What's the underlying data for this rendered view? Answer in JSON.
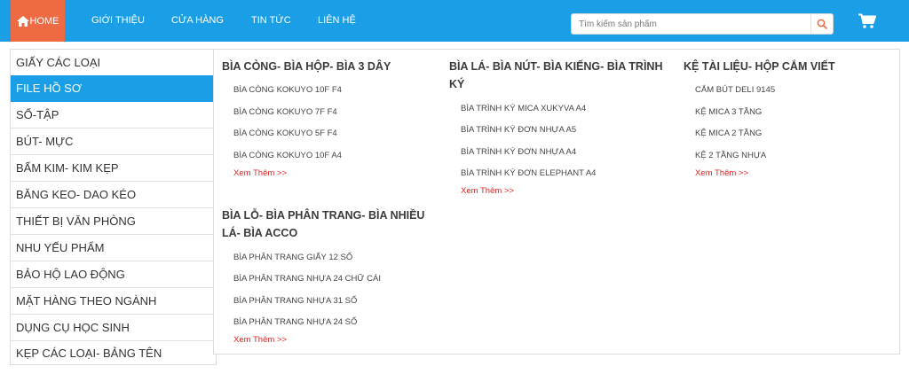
{
  "nav": {
    "home": "HOME",
    "links": [
      "GIỚI THIỆU",
      "CỬA HÀNG",
      "TIN TỨC",
      "LIÊN HỆ"
    ]
  },
  "search": {
    "placeholder": "Tìm kiếm sản phẩm",
    "value": ""
  },
  "icons": {
    "home": "home-icon",
    "search": "search-icon",
    "cart": "cart-icon"
  },
  "colors": {
    "nav_bg": "#1a9fe6",
    "home_bg": "#ee6a43",
    "active_bg": "#1a9fe6",
    "more_link": "#e02424"
  },
  "sidebar": {
    "active_index": 1,
    "items": [
      "GIẤY CÁC LOẠI",
      "FILE HỒ SƠ",
      "SỔ-TẬP",
      "BÚT- MỰC",
      "BẤM KIM- KIM KẸP",
      "BĂNG KEO- DAO KÉO",
      "THIẾT BỊ VĂN PHÒNG",
      "NHU YẾU PHẨM",
      "BẢO HỘ LAO ĐỘNG",
      "MẶT HÀNG THEO NGÀNH",
      "DỤNG CỤ HỌC SINH",
      "KẸP CÁC LOẠI- BẢNG TÊN"
    ]
  },
  "mega": {
    "more_label": "Xem Thêm >>",
    "groups": [
      {
        "title": "BÌA CÒNG- BÌA HỘP- BÌA 3 DÂY",
        "items": [
          "BÌA CÒNG KOKUYO 10F F4",
          "BÌA CÒNG KOKUYO 7F F4",
          "BÌA CÒNG KOKUYO 5F F4",
          "BÌA CÒNG KOKUYO 10F A4"
        ]
      },
      {
        "title": "BÌA LÁ- BÌA NÚT- BÌA KIẾNG- BÌA TRÌNH KÝ",
        "items": [
          "BÌA TRÌNH KÝ MICA XUKYVA A4",
          "BÌA TRÌNH KÝ ĐƠN NHỰA A5",
          "BÌA TRÌNH KÝ ĐƠN NHỰA A4",
          "BÌA TRÌNH KÝ ĐƠN ELEPHANT A4"
        ]
      },
      {
        "title": "KỆ TÀI LIỆU- HỘP CẮM VIẾT",
        "items": [
          "CẮM BÚT DELI 9145",
          "KỆ MICA 3 TẦNG",
          "KỆ MICA 2 TẦNG",
          "KỆ 2 TẦNG NHỰA"
        ]
      },
      {
        "title": "BÌA LỖ- BÌA PHÂN TRANG- BÌA NHIỀU LÁ- BÌA ACCO",
        "items": [
          "BÌA PHÂN TRANG GIẤY 12 SỐ",
          "BÌA PHÂN TRANG NHỰA 24 CHỮ CÁI",
          "BÌA PHÂN TRANG NHỰA 31 SỐ",
          "BÌA PHÂN TRANG NHỰA 24 SỐ"
        ]
      }
    ]
  }
}
